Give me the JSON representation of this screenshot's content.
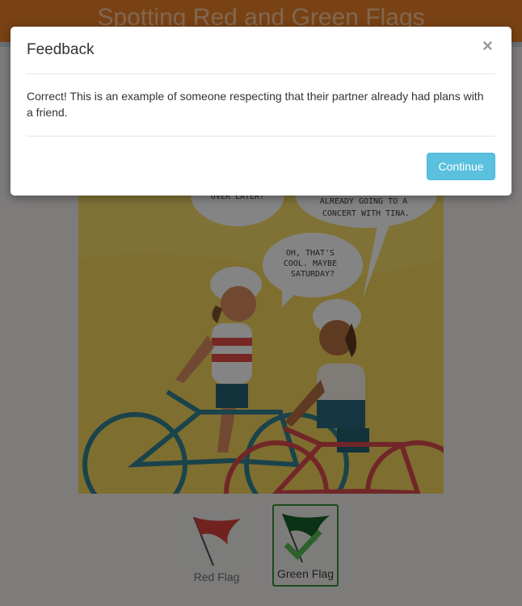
{
  "header": {
    "title": "Spotting Red and Green Flags"
  },
  "comic": {
    "bubbles": [
      {
        "text": "OVER LATER?"
      },
      {
        "text": "ALREADY GOING TO A CONCERT WITH TINA."
      },
      {
        "text": "OH, THAT'S COOL. MAYBE SATURDAY?"
      }
    ]
  },
  "choices": {
    "red_label": "Red Flag",
    "green_label": "Green Flag"
  },
  "modal": {
    "title": "Feedback",
    "close_glyph": "×",
    "body": "Correct! This is an example of someone respecting that their partner already had plans with a friend.",
    "continue_label": "Continue"
  },
  "colors": {
    "header": "#e97b1f",
    "accent_button": "#5bc0de",
    "selected_border": "#2e8b2e"
  }
}
